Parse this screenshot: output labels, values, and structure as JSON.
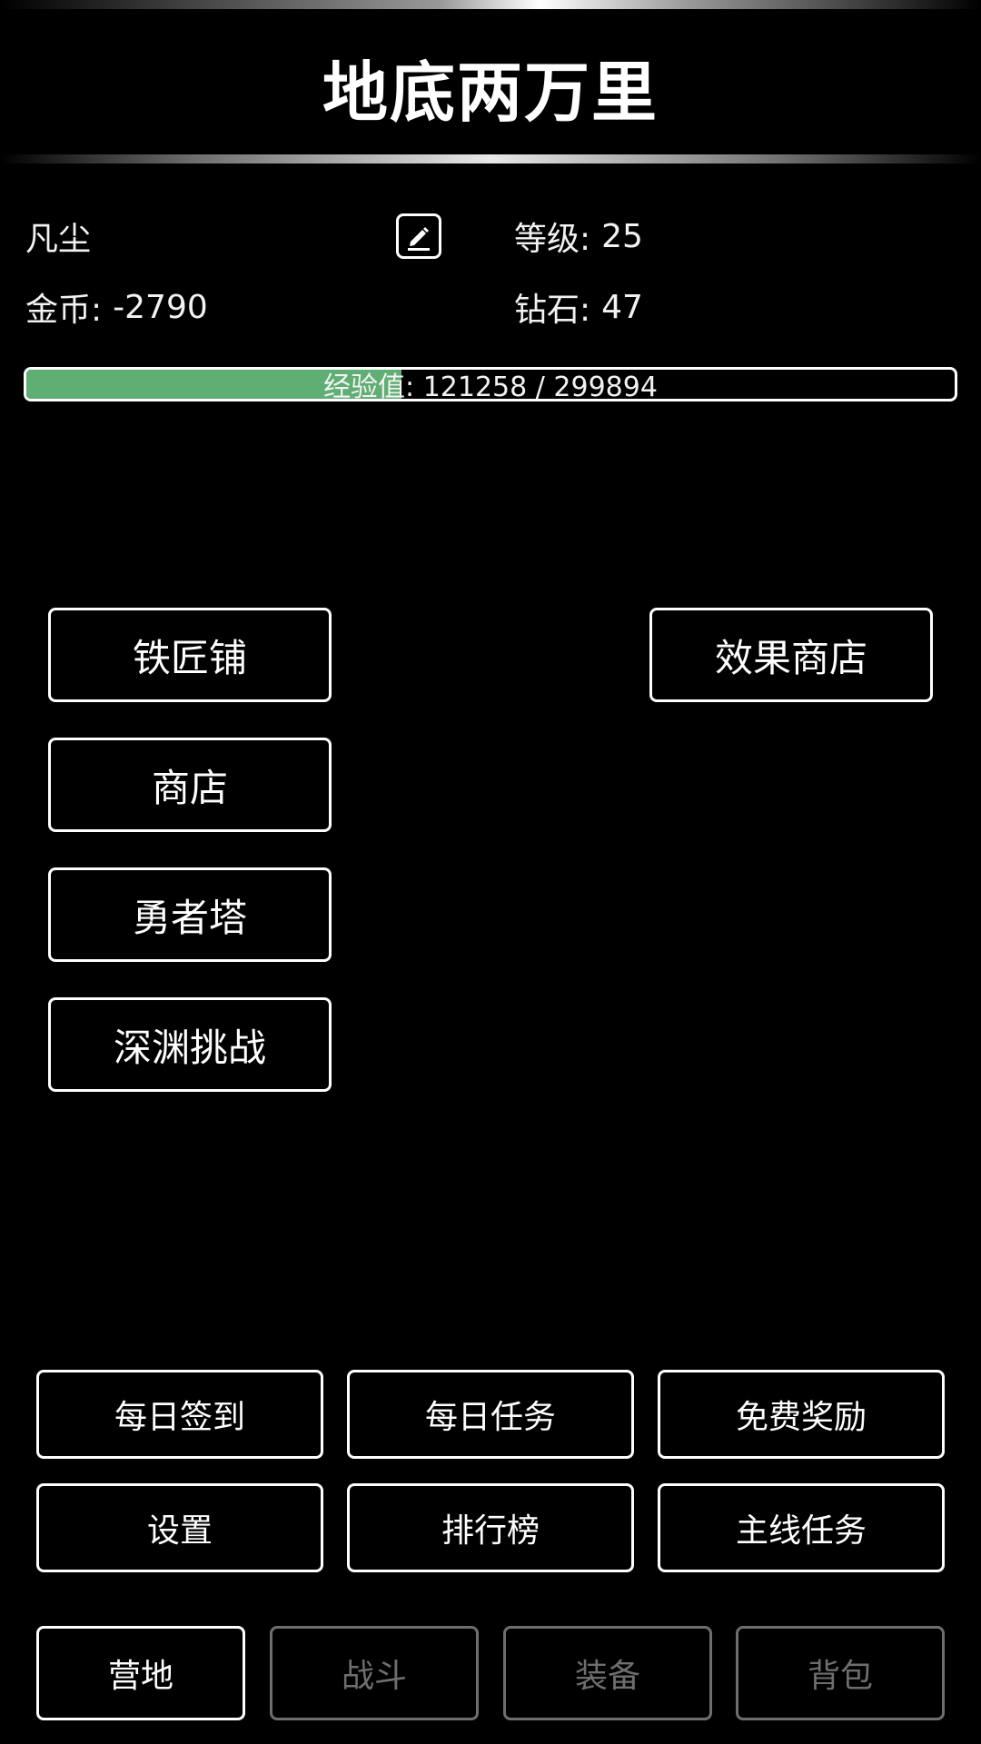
{
  "title": "地底两万里",
  "player": {
    "name": "凡尘",
    "level_label": "等级:",
    "level": "25",
    "gold_label": "金币:",
    "gold": "-2790",
    "diamond_label": "钻石:",
    "diamond": "47"
  },
  "exp": {
    "label": "经验值: 121258 / 299894",
    "current": 121258,
    "max": 299894
  },
  "menu": {
    "blacksmith": "铁匠铺",
    "shop": "商店",
    "hero_tower": "勇者塔",
    "abyss_challenge": "深渊挑战",
    "effect_shop": "效果商店"
  },
  "actions": {
    "daily_signin": "每日签到",
    "daily_tasks": "每日任务",
    "free_reward": "免费奖励",
    "settings": "设置",
    "leaderboard": "排行榜",
    "main_quest": "主线任务"
  },
  "nav": {
    "camp": "营地",
    "battle": "战斗",
    "equipment": "装备",
    "backpack": "背包"
  },
  "icons": {
    "edit": "edit-pencil-icon"
  },
  "colors": {
    "background": "#000000",
    "exp_fill": "#5fae74",
    "disabled": "#6e6e6e"
  }
}
